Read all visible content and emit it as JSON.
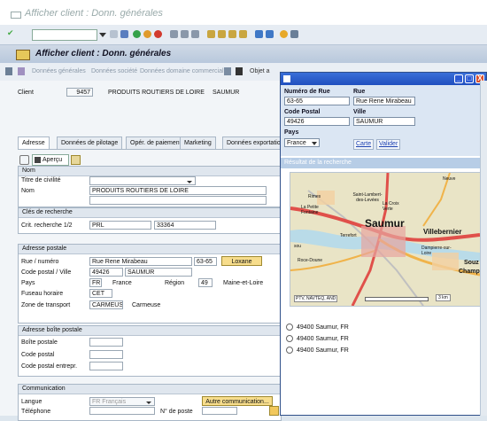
{
  "window": {
    "title": "Afficher client : Donn. générales"
  },
  "app": {
    "title": "Afficher client : Donn. générales",
    "links": [
      "Données générales",
      "Données société",
      "Données domaine commercial",
      "Objet a"
    ]
  },
  "client": {
    "label": "Client",
    "number": "9457",
    "name": "PRODUITS ROUTIERS DE LOIRE",
    "city": "SAUMUR"
  },
  "tabs": [
    "Adresse",
    "Données de pilotage",
    "Opér. de paiement",
    "Marketing",
    "Données exportation"
  ],
  "apercu_label": "Aperçu",
  "name_section": {
    "header": "Nom",
    "title_label": "Titre de civilité",
    "name_label": "Nom",
    "name_value": "PRODUITS ROUTIERS DE LOIRE"
  },
  "search_section": {
    "header": "Clés de recherche",
    "label": "Crit. recherche 1/2",
    "value1": "PRL",
    "value2": "33364"
  },
  "postal_section": {
    "header": "Adresse postale",
    "street_label": "Rue / numéro",
    "street_value": "Rue Rene Mirabeau",
    "number_value": "63-65",
    "locate_button": "Loxane",
    "city_label": "Code postal / Ville",
    "postal_code": "49426",
    "city_value": "SAUMUR",
    "country_label": "Pays",
    "country_code": "FR",
    "country_name": "France",
    "region_label": "Région",
    "region_code": "49",
    "region_name": "Maine-et-Loire",
    "timezone_label": "Fuseau horaire",
    "timezone_value": "CET",
    "transport_label": "Zone de transport",
    "transport_code": "CARMEUSE",
    "transport_name": "Carmeuse"
  },
  "pobox_section": {
    "header": "Adresse boîte postale",
    "pobox_label": "Boîte postale",
    "postal_label": "Code postal",
    "company_postal_label": "Code postal entrepr."
  },
  "comm_section": {
    "header": "Communication",
    "language_label": "Langue",
    "language_value": "FR Français",
    "other_button": "Autre communication...",
    "phone_label": "Téléphone",
    "extension_label": "N° de poste"
  },
  "popup": {
    "street_no_label": "Numéro de Rue",
    "street_label": "Rue",
    "street_no_value": "63-65",
    "street_value": "Rue Rene Mirabeau",
    "postal_label": "Code Postal",
    "city_label": "Ville",
    "postal_value": "49426",
    "city_value": "SAUMUR",
    "country_label": "Pays",
    "country_value": "France",
    "map_link": "Carte",
    "validate_link": "Valider",
    "result_header": "Résultat de la recherche",
    "map": {
      "places": [
        "Neuve",
        "Rimes",
        "Saint-Lambert-des-Levées",
        "La Croix Verte",
        "La Petite Fontaine",
        "Saumur",
        "Villebernier",
        "Terrefort",
        "Dampierre-sur-Loire",
        "Roce-Doune",
        "Souz",
        "Champ",
        "sou"
      ],
      "copyright": "PTV, NAVTEQ, AND",
      "scale": "3 km"
    },
    "results": [
      "49400 Saumur, FR",
      "49400 Saumur, FR",
      "49400 Saumur, FR"
    ]
  },
  "colors": {
    "title_bar": "#2456c7",
    "accent_button": "#f7dd8c",
    "map_road": "#e0504a"
  }
}
